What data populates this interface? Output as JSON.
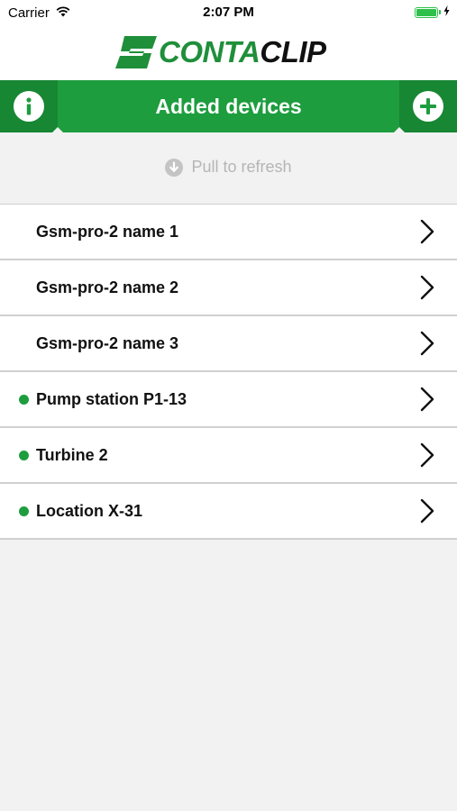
{
  "status_bar": {
    "carrier": "Carrier",
    "time": "2:07 PM",
    "wifi_icon": "wifi-icon",
    "battery_icon": "battery-icon",
    "battery_level": 1.0,
    "charging_icon": "bolt-icon"
  },
  "logo": {
    "word_conta": "CONTA",
    "word_clip": "CLIP",
    "brand_green": "#1f8f3a"
  },
  "nav": {
    "title": "Added devices",
    "info_icon": "info-icon",
    "add_icon": "plus-icon",
    "bar_color": "#1e9d3f"
  },
  "refresh": {
    "label": "Pull to refresh",
    "icon": "arrow-down-circle-icon"
  },
  "devices": [
    {
      "name": "Gsm-pro-2 name 1",
      "online": false
    },
    {
      "name": "Gsm-pro-2 name 2",
      "online": false
    },
    {
      "name": "Gsm-pro-2 name 3",
      "online": false
    },
    {
      "name": "Pump station P1-13",
      "online": true
    },
    {
      "name": "Turbine 2",
      "online": true
    },
    {
      "name": "Location X-31",
      "online": true
    }
  ]
}
